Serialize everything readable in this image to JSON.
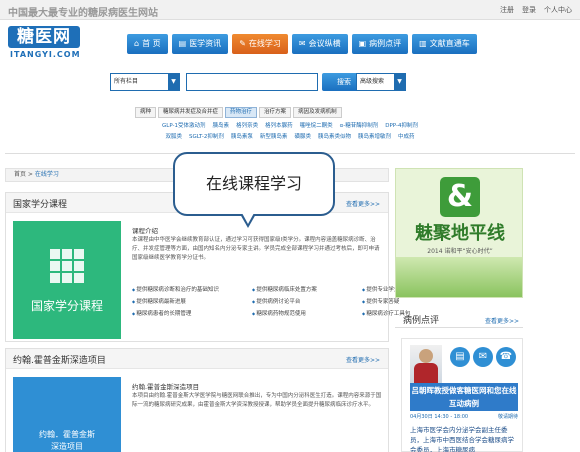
{
  "topbar": {
    "slogan": "中国最大最专业的糖尿病医生网站",
    "links": [
      "注册",
      "登录",
      "个人中心"
    ]
  },
  "logo": {
    "main": "糖医网",
    "sub": "ITANGYI.COM"
  },
  "nav": [
    {
      "icon": "home-icon",
      "glyph": "⌂",
      "label": "首 页"
    },
    {
      "icon": "news-icon",
      "glyph": "▤",
      "label": "医学资讯"
    },
    {
      "icon": "learn-icon",
      "glyph": "✎",
      "label": "在线学习"
    },
    {
      "icon": "chat-icon",
      "glyph": "✉",
      "label": "会议纵横"
    },
    {
      "icon": "case-icon",
      "glyph": "▣",
      "label": "病例点评"
    },
    {
      "icon": "doc-icon",
      "glyph": "▥",
      "label": "文献直通车"
    }
  ],
  "search": {
    "category": "所有栏目",
    "button": "搜索",
    "advanced": "高级搜索"
  },
  "subtabs": [
    "病种",
    "糖尿病并发症及合并症",
    "药物治疗",
    "治疗方案",
    "病因及发病机制"
  ],
  "keywords": {
    "row1": [
      "GLP-1受体激动剂",
      "胰岛素",
      "格列奈类",
      "格列本脲药",
      "噻唑烷二酮类",
      "α-糖苷酶抑制剂",
      "DPP-4抑制剂"
    ],
    "row2": [
      "双胍类",
      "SGLT-2抑制剂",
      "胰岛素泵",
      "新型胰岛素",
      "磺脲类",
      "胰岛素类似物",
      "胰岛素增敏剂",
      "中成药"
    ]
  },
  "breadcrumb": {
    "home": "首页",
    "sep": " > ",
    "current": "在线学习"
  },
  "bubble": {
    "text": "在线课程学习"
  },
  "course1": {
    "title": "国家学分课程",
    "more": "查看更多>>",
    "tile": "国家学分课程",
    "intro_title": "课程介绍",
    "intro_text": "本课程由中华医学会继续教育部认证，通过学习可获得国家级I类学分。课程内容涵盖糖尿病诊断、治疗、并发症管理等方面，由国内知名内分泌专家主讲。学员完成全部课程学习并通过考核后，即可申请国家级继续医学教育学分证书。",
    "bullets": [
      "提供糖尿病诊断和治疗的基础知识",
      "提供糖尿病临床处置方案",
      "提供专业学分证明",
      "提供糖尿病最新进展",
      "提供病例讨论平台",
      "提供专家答疑",
      "糖尿病患者的长期管理",
      "糖尿病药物规范使用",
      "糖尿病诊疗工具包"
    ]
  },
  "course2": {
    "title": "约翰.霍普金斯深造项目",
    "more": "查看更多>>",
    "tile_line1": "约翰．霍普金斯",
    "tile_line2": "深造项目",
    "intro_title": "约翰.霍普金斯深造项目",
    "intro_text": "本项目由约翰.霍普金斯大学医学院与糖医网联合推出，专为中国内分泌科医生打造。课程内容来源于国际一流的糖尿病研究成果，由霍普金斯大学资深教授授课，帮助学员全面提升糖尿病临床诊疗水平。"
  },
  "ad1": {
    "title": "魅聚地平线",
    "sub": "2014 诺和平“安心时代”"
  },
  "side": {
    "title": "病例点评",
    "more": "查看更多>>"
  },
  "ad2": {
    "headline": "吕朝晖教授做客糖医网和您在线互动病例",
    "date": "04月30日 14:30 - 18:00",
    "tag": "敬请期待",
    "foot": "上海市医学会内分泌学会副主任委员，上海市中西医结合学会糖尿病学会委员，上海市糖尿病"
  }
}
